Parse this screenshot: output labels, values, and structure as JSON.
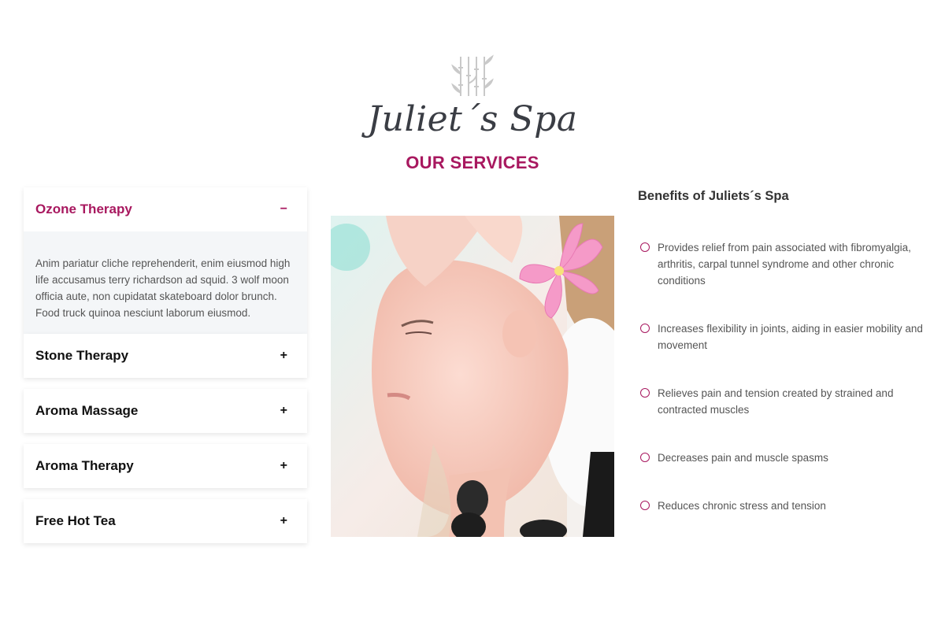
{
  "brand": {
    "logo_text": "Juliet´s Spa",
    "logo_icon": "bamboo-icon"
  },
  "section": {
    "title": "OUR SERVICES"
  },
  "accordion": {
    "items": [
      {
        "title": "Ozone Therapy",
        "toggle": "−",
        "open": true,
        "body": "Anim pariatur cliche reprehenderit, enim eiusmod high life accusamus terry richardson ad squid. 3 wolf moon officia aute, non cupidatat skateboard dolor brunch. Food truck quinoa nesciunt laborum eiusmod."
      },
      {
        "title": "Stone Therapy",
        "toggle": "+"
      },
      {
        "title": "Aroma Massage",
        "toggle": "+"
      },
      {
        "title": "Aroma Therapy",
        "toggle": "+"
      },
      {
        "title": "Free Hot Tea",
        "toggle": "+"
      }
    ]
  },
  "benefits": {
    "title": "Benefits of Juliets´s Spa",
    "items": [
      "Provides relief from pain associated with fibromyalgia, arthritis, carpal tunnel syndrome and other chronic conditions",
      "Increases flexibility in joints, aiding in easier mobility and movement",
      "Relieves pain and tension created by strained and contracted muscles",
      "Decreases pain and muscle spasms",
      "Reduces chronic stress and tension"
    ]
  },
  "colors": {
    "accent": "#a8185f",
    "heading": "#3a3d44",
    "panel": "#f4f6f8"
  }
}
